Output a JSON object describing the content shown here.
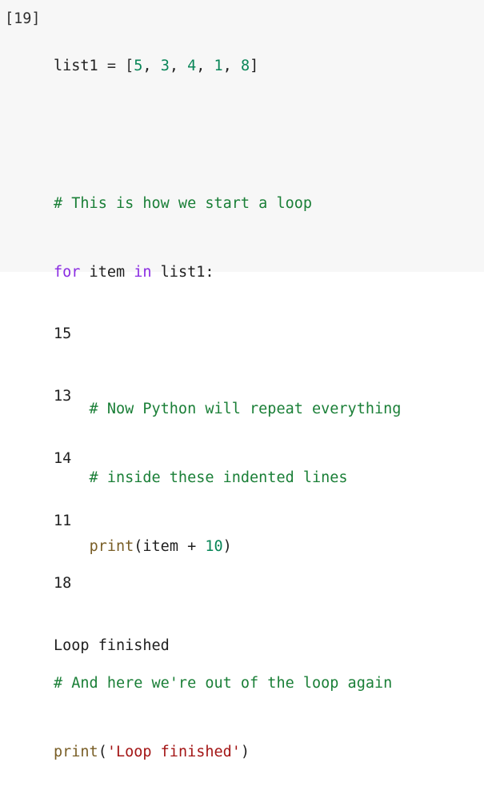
{
  "cell": {
    "prompt": "[19]",
    "code": {
      "l1": {
        "a": "list1",
        "b": " = [",
        "n1": "5",
        "c1": ", ",
        "n2": "3",
        "c2": ", ",
        "n3": "4",
        "c3": ", ",
        "n4": "1",
        "c4": ", ",
        "n5": "8",
        "close": "]"
      },
      "l3": "# This is how we start a loop",
      "l4": {
        "kw1": "for",
        "v1": " item ",
        "kw2": "in",
        "v2": " list1:"
      },
      "l6": "    # Now Python will repeat everything",
      "l7": "    # inside these indented lines",
      "l8": {
        "indent": "    ",
        "fn": "print",
        "open": "(item + ",
        "num": "10",
        "close": ")"
      },
      "l10": "# And here we're out of the loop again",
      "l11": {
        "fn": "print",
        "open": "(",
        "str": "'Loop finished'",
        "close": ")"
      }
    }
  },
  "output": {
    "lines": [
      "15",
      "13",
      "14",
      "11",
      "18",
      "Loop finished"
    ]
  }
}
